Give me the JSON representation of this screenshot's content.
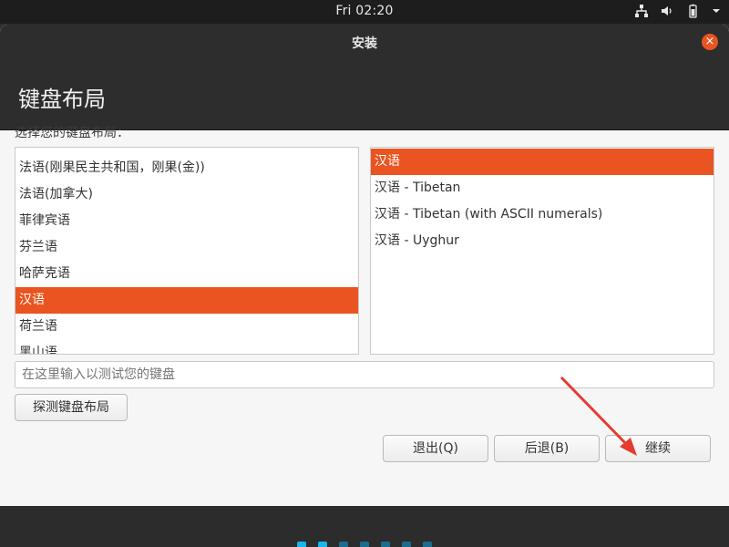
{
  "topbar": {
    "clock": "Fri 02:20"
  },
  "window": {
    "title": "安装",
    "close_icon": "×",
    "page_title": "键盘布局",
    "prompt": "选择您的键盘布局："
  },
  "layouts": [
    {
      "label": "法语(刚果民主共和国，刚果(金))",
      "selected": false
    },
    {
      "label": "法语(加拿大)",
      "selected": false
    },
    {
      "label": "菲律宾语",
      "selected": false
    },
    {
      "label": "芬兰语",
      "selected": false
    },
    {
      "label": "哈萨克语",
      "selected": false
    },
    {
      "label": "汉语",
      "selected": true
    },
    {
      "label": "荷兰语",
      "selected": false
    },
    {
      "label": "黑山语",
      "selected": false
    }
  ],
  "variants": [
    {
      "label": "汉语",
      "selected": true
    },
    {
      "label": "汉语 - Tibetan",
      "selected": false
    },
    {
      "label": "汉语 - Tibetan (with ASCII numerals)",
      "selected": false
    },
    {
      "label": "汉语 - Uyghur",
      "selected": false
    }
  ],
  "test_input": {
    "placeholder": "在这里输入以测试您的键盘",
    "value": ""
  },
  "buttons": {
    "detect": "探测键盘布局",
    "quit": "退出(Q)",
    "back": "后退(B)",
    "continue": "继续"
  },
  "progress_dots": {
    "total": 7,
    "current": 2
  },
  "colors": {
    "accent": "#e95420",
    "dot_active": "#19b6ee",
    "dot_inactive": "#1a6d8f",
    "annotation_arrow": "#e53b2f"
  }
}
